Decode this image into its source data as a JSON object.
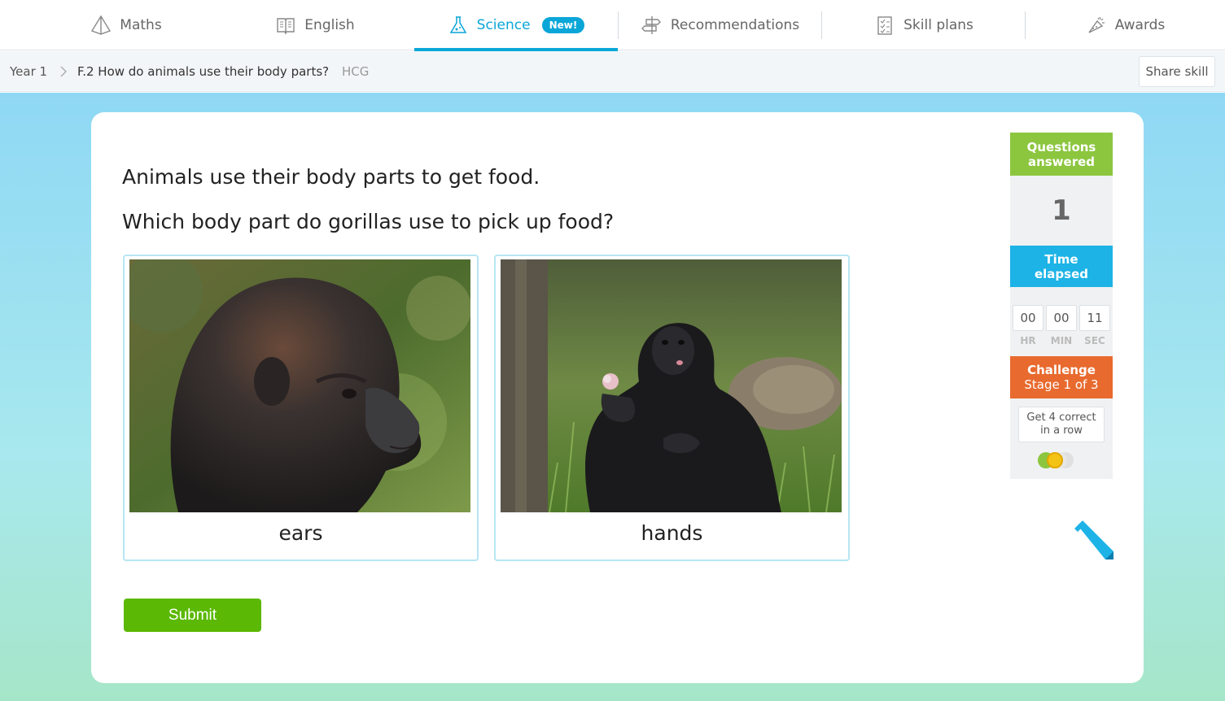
{
  "nav": {
    "tabs": [
      {
        "label": "Maths",
        "icon": "maths-pyramid-icon"
      },
      {
        "label": "English",
        "icon": "english-book-icon"
      },
      {
        "label": "Science",
        "icon": "science-flask-icon",
        "badge": "New!",
        "active": true
      },
      {
        "label": "Recommendations",
        "icon": "recommendations-signpost-icon"
      },
      {
        "label": "Skill plans",
        "icon": "skill-plans-checklist-icon"
      },
      {
        "label": "Awards",
        "icon": "awards-trophy-icon"
      }
    ],
    "accent_color": "#0aa6d8"
  },
  "breadcrumb": {
    "year": "Year 1",
    "skill": "F.2 How do animals use their body parts?",
    "code": "HCG",
    "share_label": "Share skill"
  },
  "question": {
    "line1": "Animals use their body parts to get food.",
    "line2": "Which body part do gorillas use to pick up food?",
    "choices": [
      {
        "label": "ears",
        "image": "gorilla-profile-photo"
      },
      {
        "label": "hands",
        "image": "gorilla-sitting-eating-photo"
      }
    ],
    "submit_label": "Submit"
  },
  "sidebar": {
    "questions_answered_label": "Questions answered",
    "questions_answered_value": "1",
    "time_elapsed_label": "Time elapsed",
    "time": {
      "hr": "00",
      "min": "00",
      "sec": "11"
    },
    "time_units": {
      "hr": "HR",
      "min": "MIN",
      "sec": "SEC"
    },
    "challenge_title": "Challenge",
    "challenge_stage": "Stage 1 of 3",
    "challenge_goal": "Get 4 correct in a row",
    "progress_correct": 1,
    "progress_total": 4
  },
  "colors": {
    "questions_answered": "#8cc63f",
    "time_elapsed": "#1db3e6",
    "challenge": "#e86a2e",
    "submit": "#5bb804"
  }
}
